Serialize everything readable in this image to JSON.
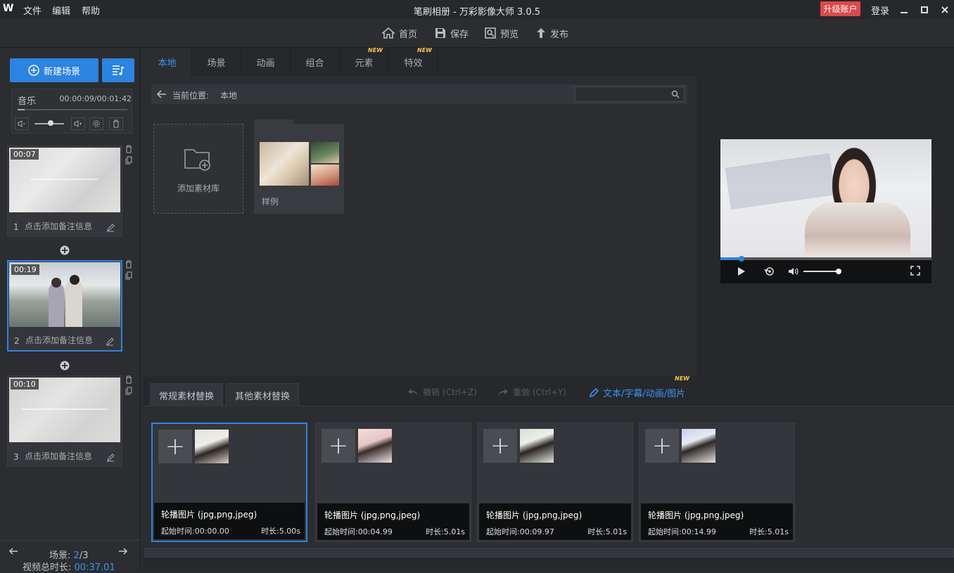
{
  "window": {
    "logo": "W",
    "title": "笔刷相册 - 万彩影像大师 3.0.5",
    "upgrade": "升级账户",
    "login": "登录",
    "menu": [
      "文件",
      "编辑",
      "帮助"
    ]
  },
  "toolbar": {
    "home": "首页",
    "save": "保存",
    "preview": "预览",
    "publish": "发布"
  },
  "left": {
    "new_scene": "新建场景",
    "music_label": "音乐",
    "music_time": "00:00:09/00:01:42",
    "scenes": [
      {
        "index": "1",
        "duration": "00:07",
        "note": "点击添加备注信息"
      },
      {
        "index": "2",
        "duration": "00:19",
        "note": "点击添加备注信息"
      },
      {
        "index": "3",
        "duration": "00:10",
        "note": "点击添加备注信息"
      }
    ],
    "scene_counter_label": "场景:",
    "scene_current": "2",
    "scene_total": "/3",
    "total_label": "视频总时长:",
    "total_value": "00:37.01"
  },
  "center": {
    "tabs": [
      {
        "label": "本地",
        "new": ""
      },
      {
        "label": "场景",
        "new": ""
      },
      {
        "label": "动画",
        "new": ""
      },
      {
        "label": "组合",
        "new": ""
      },
      {
        "label": "元素",
        "new": "NEW"
      },
      {
        "label": "特效",
        "new": "NEW"
      }
    ],
    "path_label": "当前位置:",
    "path_value": "本地",
    "search_placeholder": "",
    "add_library": "添加素材库",
    "sample": "样例"
  },
  "preview": {
    "progress": 0.1
  },
  "bottom": {
    "tab_regular": "常规素材替换",
    "tab_other": "其他素材替换",
    "undo": "撤销 (Ctrl+Z)",
    "redo": "重做 (Ctrl+Y)",
    "text_link": "文本/字幕/动画/图片",
    "text_link_new": "NEW",
    "materials": [
      {
        "title": "轮播图片 (jpg,png,jpeg)",
        "start": "起始时间:00:00.00",
        "duration": "时长:5.00s"
      },
      {
        "title": "轮播图片 (jpg,png,jpeg)",
        "start": "起始时间:00:04.99",
        "duration": "时长:5.01s"
      },
      {
        "title": "轮播图片 (jpg,png,jpeg)",
        "start": "起始时间:00:09.97",
        "duration": "时长:5.01s"
      },
      {
        "title": "轮播图片 (jpg,png,jpeg)",
        "start": "起始时间:00:14.99",
        "duration": "时长:5.01s"
      }
    ]
  },
  "colors": {
    "accent": "#2d83e0",
    "upgrade": "#e04848",
    "new_badge": "#f5c842"
  }
}
